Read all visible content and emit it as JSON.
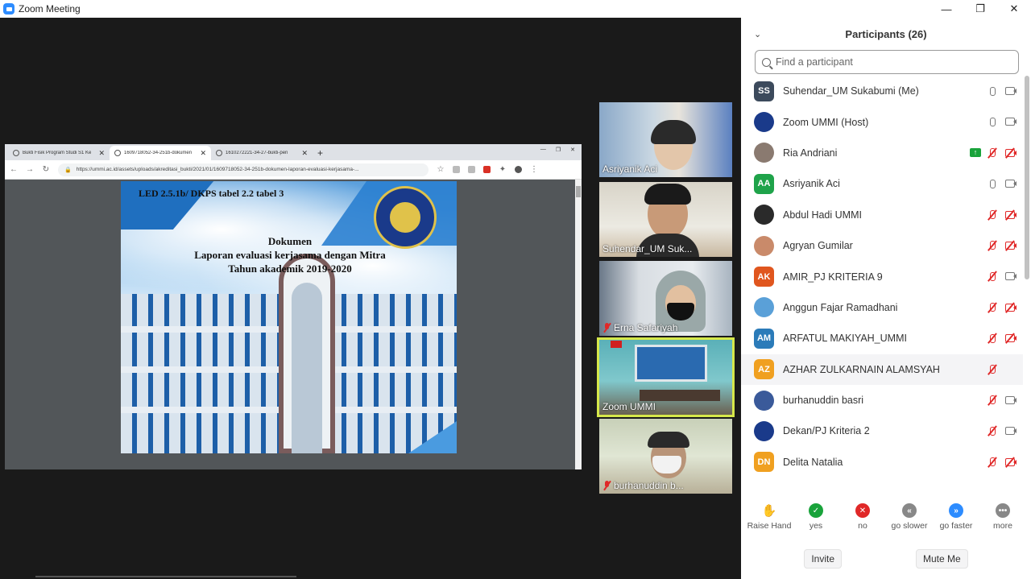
{
  "window": {
    "title": "Zoom Meeting"
  },
  "browser": {
    "tabs": [
      {
        "title": "Bukti Fisik Program Studi S1 Ke"
      },
      {
        "title": "1609718052-34-251b-dokumen"
      },
      {
        "title": "1610272221-34-27-bukti-pen"
      }
    ],
    "url": "https://ummi.ac.id/assets/uploads/akreditasi_bukti/2021/01/1609718052-34-251b-dokumen-laporan-evaluasi-kerjasama-..."
  },
  "document": {
    "led": "LED 2.5.1b/ DKPS tabel 2.2 tabel 3",
    "heading_line1": "Dokumen",
    "heading_line2": "Laporan evaluasi kerjasama dengan Mitra",
    "heading_line3": "Tahun akademik 2019-2020"
  },
  "video_tiles": [
    {
      "name": "Asriyanik Aci",
      "muted": false
    },
    {
      "name": "Suhendar_UM Suk...",
      "muted": false
    },
    {
      "name": "Erna Safariyah",
      "muted": true
    },
    {
      "name": "Zoom UMMI",
      "muted": false,
      "active": true
    },
    {
      "name": "burhanuddin b...",
      "muted": true
    }
  ],
  "participants_panel": {
    "title": "Participants (26)",
    "search_placeholder": "Find a participant",
    "participants": [
      {
        "name": "Suhendar_UM Sukabumi (Me)",
        "initials": "SS",
        "color": "#3c4a5c",
        "mic": "on",
        "cam": "on"
      },
      {
        "name": "Zoom UMMI (Host)",
        "initials": "",
        "color": "#1a3a8a",
        "mic": "on",
        "cam": "on"
      },
      {
        "name": "Ria Andriani",
        "initials": "",
        "color": "#8a7a70",
        "mic": "off",
        "cam": "off",
        "sharing": true
      },
      {
        "name": "Asriyanik Aci",
        "initials": "AA",
        "color": "#1fa34a",
        "mic": "on",
        "cam": "on"
      },
      {
        "name": "Abdul Hadi UMMI",
        "initials": "",
        "color": "#2a2a2a",
        "mic": "off",
        "cam": "off"
      },
      {
        "name": "Agryan Gumilar",
        "initials": "",
        "color": "#c98a6a",
        "mic": "off",
        "cam": "off"
      },
      {
        "name": "AMIR_PJ KRITERIA 9",
        "initials": "AK",
        "color": "#e0561e",
        "mic": "off",
        "cam": "on"
      },
      {
        "name": "Anggun Fajar Ramadhani",
        "initials": "",
        "color": "#5aa0d8",
        "mic": "off",
        "cam": "off"
      },
      {
        "name": "ARFATUL MAKIYAH_UMMI",
        "initials": "AM",
        "color": "#2b7bb9",
        "mic": "off",
        "cam": "off"
      },
      {
        "name": "AZHAR ZULKARNAIN ALAMSYAH",
        "initials": "AZ",
        "color": "#f0a020",
        "mic": "off",
        "cam": "none",
        "hover": true
      },
      {
        "name": "burhanuddin basri",
        "initials": "",
        "color": "#3a5a9a",
        "mic": "off",
        "cam": "on"
      },
      {
        "name": "Dekan/PJ Kriteria 2",
        "initials": "",
        "color": "#1a3a8a",
        "mic": "off",
        "cam": "on"
      },
      {
        "name": "Delita Natalia",
        "initials": "DN",
        "color": "#f0a020",
        "mic": "off",
        "cam": "off"
      }
    ],
    "reactions": [
      {
        "label": "Raise Hand",
        "color": "#2d8cff",
        "glyph": "✋"
      },
      {
        "label": "yes",
        "color": "#19a33b",
        "glyph": "✓"
      },
      {
        "label": "no",
        "color": "#e02828",
        "glyph": "✕"
      },
      {
        "label": "go slower",
        "color": "#888888",
        "glyph": "«"
      },
      {
        "label": "go faster",
        "color": "#2d8cff",
        "glyph": "»"
      },
      {
        "label": "more",
        "color": "#888888",
        "glyph": "•••"
      }
    ],
    "invite_label": "Invite",
    "mute_me_label": "Mute Me"
  }
}
